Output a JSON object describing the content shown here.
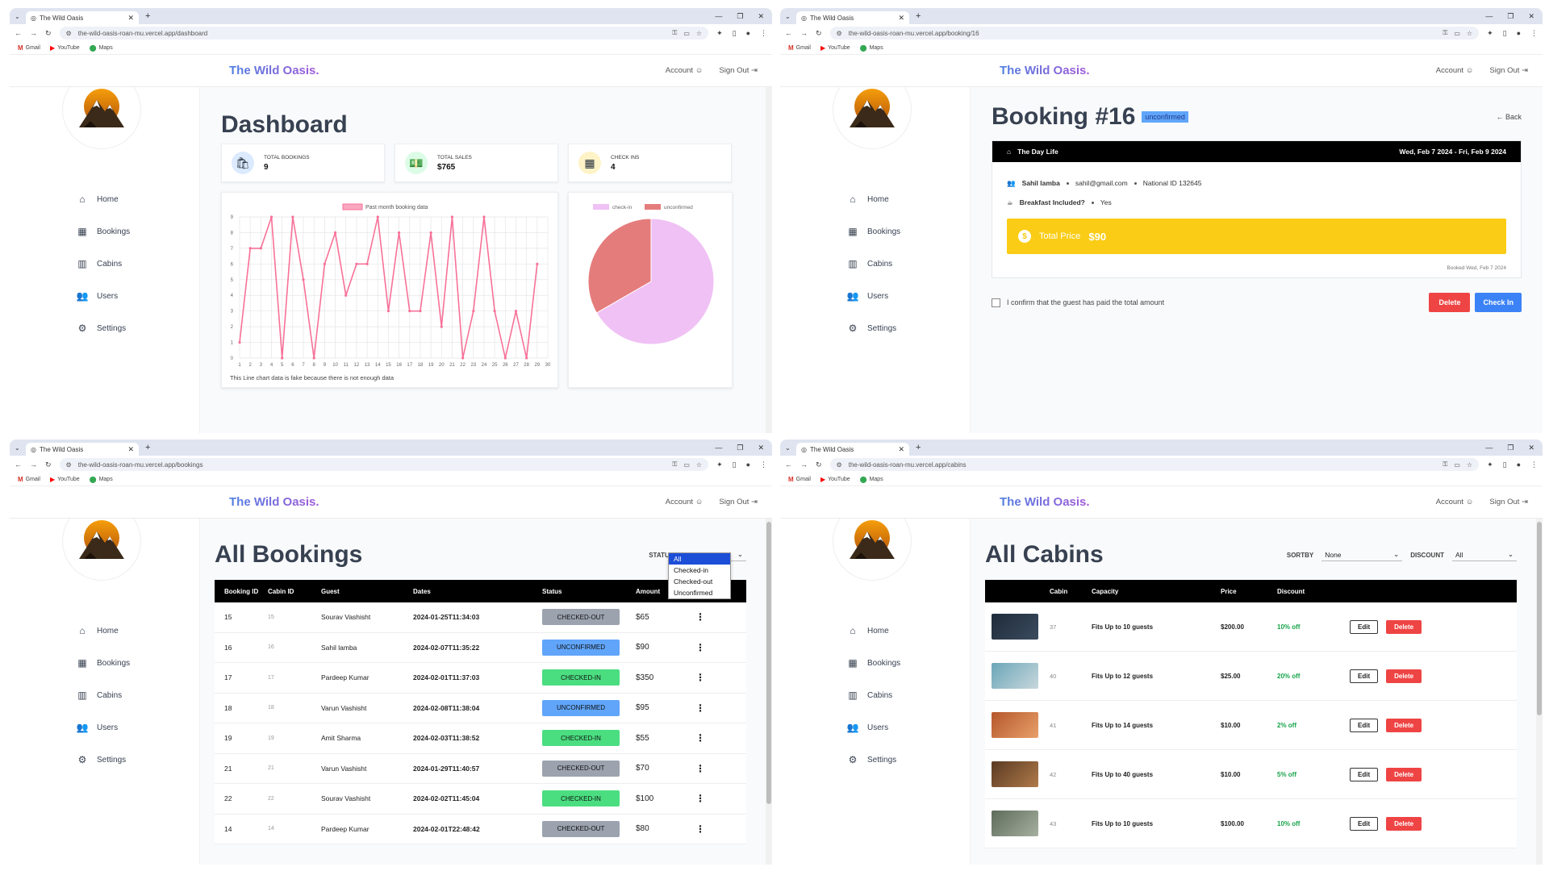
{
  "browser": {
    "tab_title": "The Wild Oasis",
    "bookmarks": [
      "Gmail",
      "YouTube",
      "Maps"
    ],
    "urls": {
      "dashboard": "the-wild-oasis-roan-mu.vercel.app/dashboard",
      "booking": "the-wild-oasis-roan-mu.vercel.app/booking/16",
      "bookings": "the-wild-oasis-roan-mu.vercel.app/bookings",
      "cabins": "the-wild-oasis-roan-mu.vercel.app/cabins"
    }
  },
  "app": {
    "brand": "The Wild Oasis.",
    "account": "Account",
    "sign_out": "Sign Out",
    "nav": [
      {
        "label": "Home",
        "icon": "home-icon"
      },
      {
        "label": "Bookings",
        "icon": "calendar-icon"
      },
      {
        "label": "Cabins",
        "icon": "building-icon"
      },
      {
        "label": "Users",
        "icon": "users-icon"
      },
      {
        "label": "Settings",
        "icon": "gear-icon"
      }
    ]
  },
  "dashboard": {
    "title": "Dashboard",
    "stats": [
      {
        "label": "TOTAL BOOKINGS",
        "value": "9",
        "color": "#dbeafe",
        "icon": "bag-icon"
      },
      {
        "label": "TOTAL SALES",
        "value": "$765",
        "color": "#dcfce7",
        "icon": "money-icon"
      },
      {
        "label": "CHECK INS",
        "value": "4",
        "color": "#fef3c7",
        "icon": "calendar-icon"
      }
    ],
    "note": "This Line chart data is fake because there is not enough data",
    "chart_data": [
      {
        "type": "line",
        "series": [
          {
            "name": "Past month booking data",
            "values": [
              1,
              7,
              7,
              9,
              0,
              9,
              5,
              0,
              6,
              8,
              4,
              6,
              6,
              9,
              3,
              8,
              3,
              3,
              8,
              2,
              9,
              0,
              3,
              9,
              3,
              0,
              3,
              0,
              6
            ]
          }
        ],
        "x": [
          1,
          2,
          3,
          4,
          5,
          6,
          7,
          8,
          9,
          10,
          11,
          12,
          13,
          14,
          15,
          16,
          17,
          18,
          19,
          20,
          21,
          22,
          23,
          24,
          25,
          26,
          27,
          28,
          29
        ],
        "x_ticks": [
          1,
          2,
          3,
          4,
          5,
          6,
          7,
          8,
          9,
          10,
          11,
          12,
          13,
          14,
          15,
          16,
          17,
          18,
          19,
          20,
          21,
          22,
          23,
          24,
          25,
          26,
          27,
          28,
          29,
          30
        ],
        "ylim": [
          0,
          9
        ],
        "color": "#f87198",
        "grid": true,
        "legend": "top"
      },
      {
        "type": "pie",
        "categories": [
          "check-in",
          "unconfirmed"
        ],
        "values": [
          2,
          1
        ],
        "colors": [
          "#f0c1f5",
          "#e57c7c"
        ],
        "legend": "top"
      }
    ]
  },
  "booking": {
    "title": "Booking #16",
    "badge": "unconfirmed",
    "back": "← Back",
    "cabin": "The Day Life",
    "dates": "Wed, Feb 7 2024 - Fri, Feb 9 2024",
    "guest": "Sahil lamba",
    "email": "sahil@gmail.com",
    "national_id": "National ID 132645",
    "breakfast_label": "Breakfast Included?",
    "breakfast_value": "Yes",
    "price_label": "Total Price",
    "price_value": "$90",
    "booked": "Booked Wed, Feb 7 2024",
    "confirm": "I confirm that the guest has paid the total amount",
    "delete": "Delete",
    "checkin": "Check In"
  },
  "bookings": {
    "title": "All Bookings",
    "status_label": "STATUS",
    "status_value": "All",
    "options": [
      "All",
      "Checked-in",
      "Checked-out",
      "Unconfirmed"
    ],
    "headers": [
      "Booking ID",
      "Cabin ID",
      "Guest",
      "Dates",
      "Status",
      "Amount"
    ],
    "rows": [
      {
        "id": "15",
        "cabin": "15",
        "guest": "Sourav Vashisht",
        "date": "2024-01-25T11:34:03",
        "status": "CHECKED-OUT",
        "amount": "$65"
      },
      {
        "id": "16",
        "cabin": "16",
        "guest": "Sahil lamba",
        "date": "2024-02-07T11:35:22",
        "status": "UNCONFIRMED",
        "amount": "$90"
      },
      {
        "id": "17",
        "cabin": "17",
        "guest": "Pardeep Kumar",
        "date": "2024-02-01T11:37:03",
        "status": "CHECKED-IN",
        "amount": "$350"
      },
      {
        "id": "18",
        "cabin": "18",
        "guest": "Varun Vashisht",
        "date": "2024-02-08T11:38:04",
        "status": "UNCONFIRMED",
        "amount": "$95"
      },
      {
        "id": "19",
        "cabin": "19",
        "guest": "Amit Sharma",
        "date": "2024-02-03T11:38:52",
        "status": "CHECKED-IN",
        "amount": "$55"
      },
      {
        "id": "21",
        "cabin": "21",
        "guest": "Varun Vashisht",
        "date": "2024-01-29T11:40:57",
        "status": "CHECKED-OUT",
        "amount": "$70"
      },
      {
        "id": "22",
        "cabin": "22",
        "guest": "Sourav Vashisht",
        "date": "2024-02-02T11:45:04",
        "status": "CHECKED-IN",
        "amount": "$100"
      },
      {
        "id": "14",
        "cabin": "14",
        "guest": "Pardeep Kumar",
        "date": "2024-02-01T22:48:42",
        "status": "CHECKED-OUT",
        "amount": "$80"
      }
    ]
  },
  "cabins": {
    "title": "All Cabins",
    "sort_label": "SORTBY",
    "sort_value": "None",
    "discount_label": "DISCOUNT",
    "discount_value": "All",
    "headers": [
      "Cabin",
      "Capacity",
      "Price",
      "Discount"
    ],
    "edit": "Edit",
    "delete": "Delete",
    "rows": [
      {
        "cabin": "37",
        "capacity": "Fits Up to 10 guests",
        "price": "$200.00",
        "discount": "10% off",
        "img": [
          "#1e2b3a",
          "#3b4b5e"
        ]
      },
      {
        "cabin": "40",
        "capacity": "Fits Up to 12 guests",
        "price": "$25.00",
        "discount": "20% off",
        "img": [
          "#6aa6b8",
          "#c8d7dc"
        ]
      },
      {
        "cabin": "41",
        "capacity": "Fits Up to 14 guests",
        "price": "$10.00",
        "discount": "2% off",
        "img": [
          "#b5572b",
          "#e8a06a"
        ]
      },
      {
        "cabin": "42",
        "capacity": "Fits Up to 40 guests",
        "price": "$10.00",
        "discount": "5% off",
        "img": [
          "#5a3a22",
          "#b07a4a"
        ]
      },
      {
        "cabin": "43",
        "capacity": "Fits Up to 10 guests",
        "price": "$100.00",
        "discount": "10% off",
        "img": [
          "#5d6b5a",
          "#a7b0a0"
        ]
      }
    ]
  }
}
